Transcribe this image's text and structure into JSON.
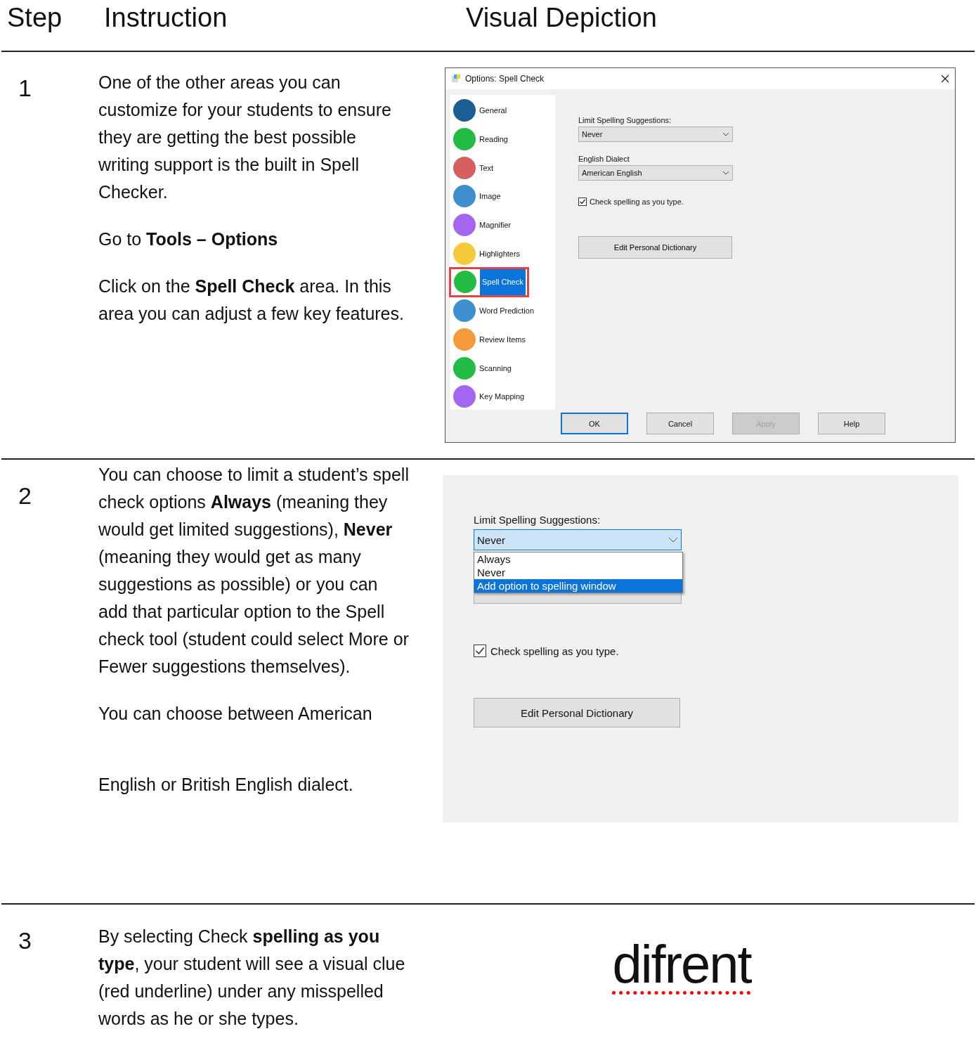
{
  "columns": [
    "Step",
    "Instruction",
    "Visual Depiction"
  ],
  "rows": [
    {
      "step": "1",
      "paragraphs": [
        "One of the other areas you can customize  for your students to ensure they are  getting the best possible writing support is  the built in Spell Checker.",
        "Go to **Tools – Options**",
        "Click on the **Spell Check** area.  In this area you can adjust a few key features."
      ],
      "visual": {
        "kind": "dialog",
        "title": "Options: Spell Check",
        "sidebar": [
          {
            "label": "General",
            "color": "#1b5e95",
            "selected": false
          },
          {
            "label": "Reading",
            "color": "#22bb44",
            "selected": false
          },
          {
            "label": "Text",
            "color": "#d46060",
            "selected": false
          },
          {
            "label": "Image",
            "color": "#3d8fcf",
            "selected": false
          },
          {
            "label": "Magnifier",
            "color": "#a466f0",
            "selected": false
          },
          {
            "label": "Highlighters",
            "color": "#f5c93a",
            "selected": false
          },
          {
            "label": "Spell Check",
            "color": "#22bb44",
            "selected": true
          },
          {
            "label": "Word Prediction",
            "color": "#3d8fcf",
            "selected": false
          },
          {
            "label": "Review Items",
            "color": "#f59a3a",
            "selected": false
          },
          {
            "label": "Scanning",
            "color": "#22bb44",
            "selected": false
          },
          {
            "label": "Key Mapping",
            "color": "#a466f0",
            "selected": false
          }
        ],
        "limit_label": "Limit Spelling Suggestions:",
        "limit_value": "Never",
        "dialect_label": "English Dialect",
        "dialect_value": "American English",
        "checkbox": {
          "label": "Check spelling as you type.",
          "checked": true
        },
        "dictionary_button": "Edit Personal Dictionary",
        "buttons": [
          {
            "label": "OK",
            "kind": "default"
          },
          {
            "label": "Cancel",
            "kind": "normal"
          },
          {
            "label": "Apply",
            "kind": "disabled"
          },
          {
            "label": "Help",
            "kind": "normal"
          }
        ]
      }
    },
    {
      "step": "2",
      "paragraphs": [
        "You can choose to limit a student’s spell check options **Always** (meaning they would get limited suggestions), **Never** (meaning they would get as many suggestions as possible) or you can add that particular option to the Spell check tool (student could select More or Fewer suggestions themselves).",
        "You can choose between American",
        "English or British English dialect."
      ],
      "visual": {
        "kind": "dropdown",
        "limit_label": "Limit Spelling Suggestions:",
        "limit_value": "Never",
        "options": [
          {
            "label": "Always",
            "selected": false
          },
          {
            "label": "Never",
            "selected": false
          },
          {
            "label": "Add option to spelling window",
            "selected": true
          }
        ],
        "checkbox": {
          "label": "Check spelling as you type.",
          "checked": true
        },
        "dictionary_button": "Edit Personal Dictionary"
      }
    },
    {
      "step": "3",
      "paragraphs": [
        "By selecting Check **spelling as you type**, your student will see a visual clue (red underline) under any misspelled words as he or she types."
      ],
      "visual": {
        "kind": "word",
        "word": "difrent",
        "misspelled": true
      }
    }
  ]
}
